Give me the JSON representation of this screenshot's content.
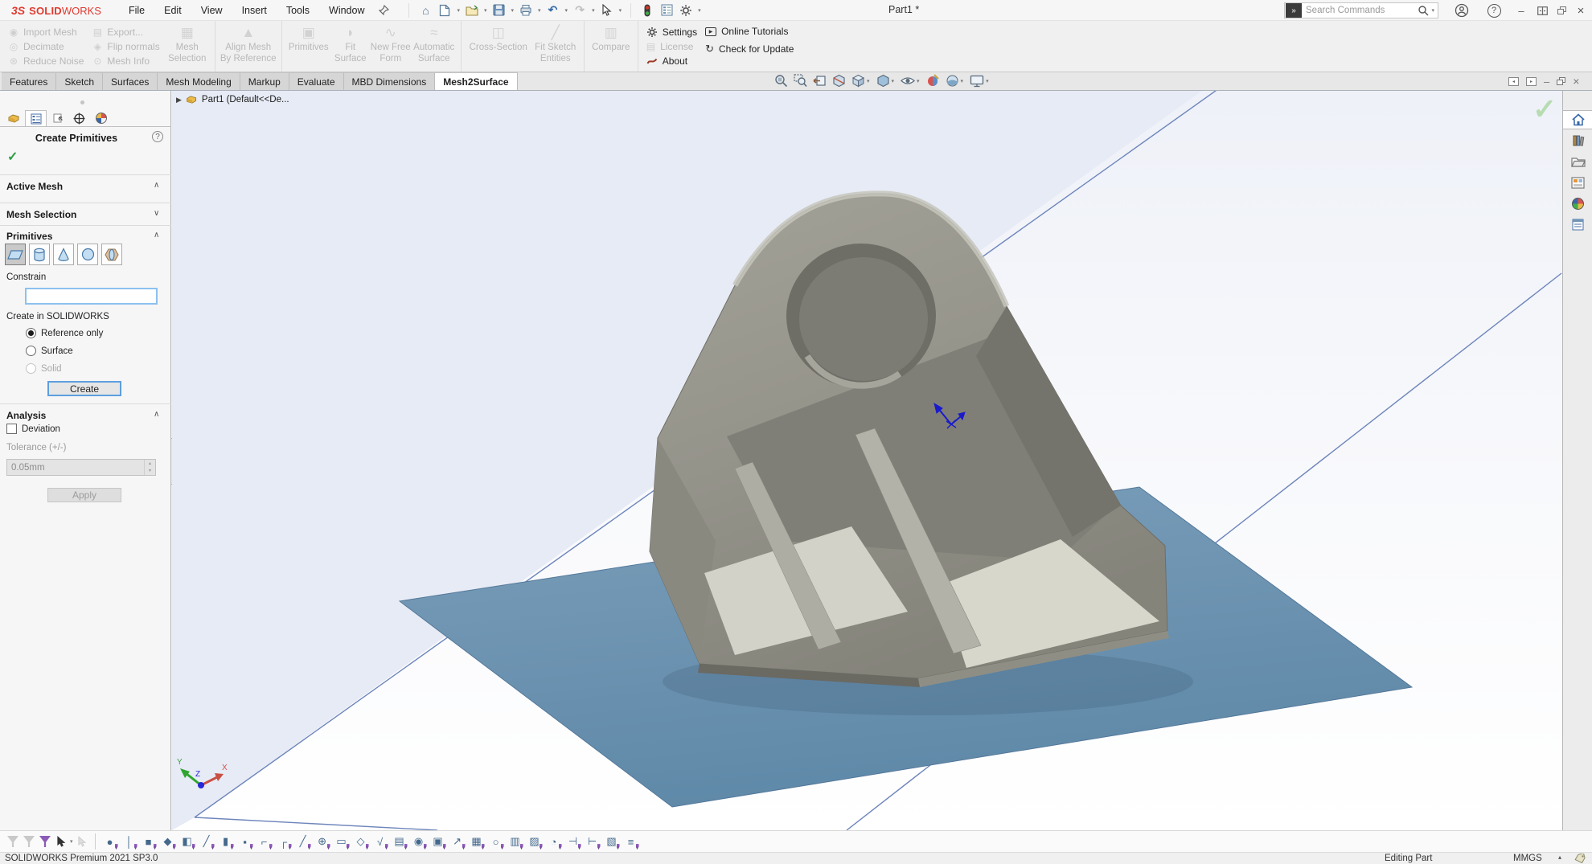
{
  "colors": {
    "sw_red": "#e03a2f",
    "plane_blue": "#6d93b2",
    "focus_blue": "#5e9ede",
    "check_green": "#2f9e44",
    "confirm_green": "#b7dcb2",
    "disabled_gray": "#b8b8b8",
    "pin_purple": "#8b5bb5"
  },
  "titlebar": {
    "logo_prefix": "3S",
    "logo_bold": "SOLID",
    "logo_light": "WORKS",
    "menus": [
      {
        "label": "File",
        "name": "menu-file"
      },
      {
        "label": "Edit",
        "name": "menu-edit"
      },
      {
        "label": "View",
        "name": "menu-view"
      },
      {
        "label": "Insert",
        "name": "menu-insert"
      },
      {
        "label": "Tools",
        "name": "menu-tools"
      },
      {
        "label": "Window",
        "name": "menu-window"
      }
    ],
    "doc_title": "Part1 *",
    "search_placeholder": "Search Commands"
  },
  "ribbon": {
    "import_mesh": "Import Mesh",
    "export_label": "Export...",
    "decimate": "Decimate",
    "flip_normals": "Flip normals",
    "reduce_noise": "Reduce Noise",
    "mesh_info": "Mesh Info",
    "mesh_selection_l1": "Mesh",
    "mesh_selection_l2": "Selection",
    "align_l1": "Align Mesh",
    "align_l2": "By Reference",
    "primitives": "Primitives",
    "fit_surface_l1": "Fit",
    "fit_surface_l2": "Surface",
    "new_free_form_l1": "New Free",
    "new_free_form_l2": "Form",
    "auto_surface_l1": "Automatic",
    "auto_surface_l2": "Surface",
    "cross_section": "Cross-Section",
    "fit_sketch_l1": "Fit Sketch",
    "fit_sketch_l2": "Entities",
    "compare": "Compare",
    "settings": "Settings",
    "license": "License",
    "about": "About",
    "online_tutorials": "Online Tutorials",
    "check_update": "Check for Update"
  },
  "tabs": {
    "items": [
      {
        "label": "Features",
        "name": "tab-features"
      },
      {
        "label": "Sketch",
        "name": "tab-sketch"
      },
      {
        "label": "Surfaces",
        "name": "tab-surfaces"
      },
      {
        "label": "Mesh Modeling",
        "name": "tab-mesh-modeling"
      },
      {
        "label": "Markup",
        "name": "tab-markup"
      },
      {
        "label": "Evaluate",
        "name": "tab-evaluate"
      },
      {
        "label": "MBD Dimensions",
        "name": "tab-mbd-dimensions"
      },
      {
        "label": "Mesh2Surface",
        "name": "tab-mesh2surface",
        "active": true
      }
    ]
  },
  "pm": {
    "title": "Create Primitives",
    "help_glyph": "?",
    "ok_glyph": "✓",
    "active_mesh": "Active Mesh",
    "mesh_selection": "Mesh Selection",
    "primitives": "Primitives",
    "chev_up": "∧",
    "chev_down": "∨",
    "constrain": "Constrain",
    "create_in": "Create in SOLIDWORKS",
    "radios": [
      {
        "label": "Reference only",
        "name": "radio-reference-only",
        "selected": true
      },
      {
        "label": "Surface",
        "name": "radio-surface"
      },
      {
        "label": "Solid",
        "name": "radio-solid",
        "disabled": true
      }
    ],
    "create_btn": "Create",
    "analysis": "Analysis",
    "deviation": "Deviation",
    "tolerance_label": "Tolerance (+/-)",
    "tolerance_value": "0.05mm",
    "apply_btn": "Apply"
  },
  "viewport": {
    "tree_label": "Part1  (Default<<De...",
    "check_glyph": "✓",
    "axis_x": "X",
    "axis_y": "Y",
    "axis_z": "Z"
  },
  "bottom_toolbar": {
    "tools": [
      {
        "glyph": "●"
      },
      {
        "glyph": "│"
      },
      {
        "glyph": "■"
      },
      {
        "glyph": "◆"
      },
      {
        "glyph": "◧"
      },
      {
        "glyph": "╱"
      },
      {
        "glyph": "▮"
      },
      {
        "glyph": "▪"
      },
      {
        "glyph": "⌐"
      },
      {
        "glyph": "┌"
      },
      {
        "glyph": "╱"
      },
      {
        "glyph": "⊕"
      },
      {
        "glyph": "▭"
      },
      {
        "glyph": "◇"
      },
      {
        "glyph": "√"
      },
      {
        "glyph": "▤"
      },
      {
        "glyph": "◉"
      },
      {
        "glyph": "▣"
      },
      {
        "glyph": "↗"
      },
      {
        "glyph": "▦"
      },
      {
        "glyph": "○"
      },
      {
        "glyph": "▥"
      },
      {
        "glyph": "▨"
      },
      {
        "glyph": "◔"
      },
      {
        "glyph": "⊣"
      },
      {
        "glyph": "⊢"
      },
      {
        "glyph": "▧"
      },
      {
        "glyph": "≡"
      }
    ]
  },
  "statusbar": {
    "product": "SOLIDWORKS Premium 2021 SP3.0",
    "mode": "Editing Part",
    "units": "MMGS"
  }
}
